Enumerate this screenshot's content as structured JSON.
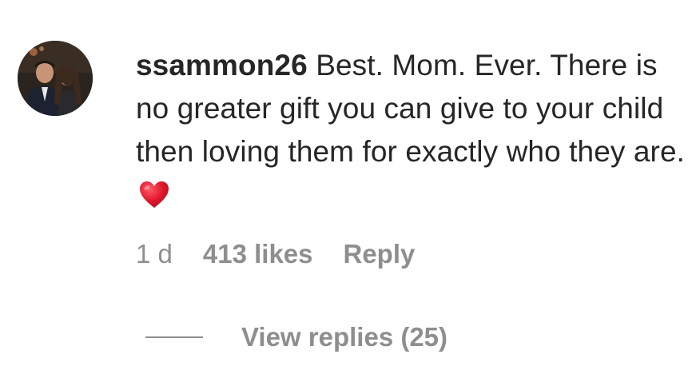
{
  "comment": {
    "username": "ssammon26",
    "text": "Best. Mom. Ever. There is no greater gift you can give to your child then loving them for exactly who they are.",
    "emoji_icon": "red-heart-icon"
  },
  "meta": {
    "time": "1 d",
    "likes": "413 likes",
    "reply_label": "Reply"
  },
  "replies": {
    "label": "View replies (25)"
  },
  "colors": {
    "text": "#262626",
    "secondary": "#8e8e8e",
    "heart": "#e0162b"
  }
}
